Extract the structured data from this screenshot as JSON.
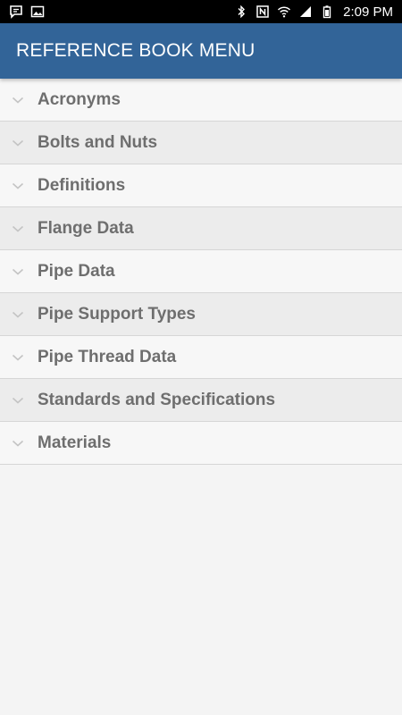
{
  "status_bar": {
    "time": "2:09 PM",
    "left_icons": [
      "message-icon",
      "image-icon"
    ],
    "right_icons": [
      "bluetooth-icon",
      "nfc-icon",
      "wifi-icon",
      "signal-icon",
      "battery-icon"
    ]
  },
  "header": {
    "title": "REFERENCE BOOK MENU"
  },
  "colors": {
    "appbar": "#326498",
    "label": "#6e6e6e"
  },
  "menu": {
    "items": [
      {
        "label": "Acronyms"
      },
      {
        "label": "Bolts and Nuts"
      },
      {
        "label": "Definitions"
      },
      {
        "label": "Flange Data"
      },
      {
        "label": "Pipe Data"
      },
      {
        "label": "Pipe Support Types"
      },
      {
        "label": "Pipe Thread Data"
      },
      {
        "label": "Standards and Specifications"
      },
      {
        "label": "Materials"
      }
    ]
  }
}
